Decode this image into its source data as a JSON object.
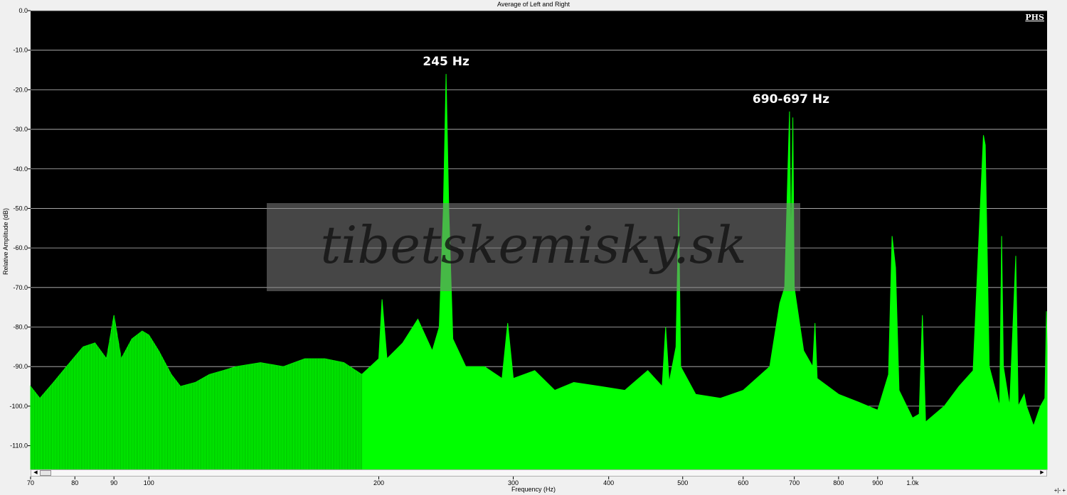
{
  "window": {
    "title": "Average of Left and Right"
  },
  "badge": "PHS",
  "watermark": "tibetskemisky.sk",
  "corner_controls": "+|- +",
  "chart_data": {
    "type": "area",
    "title": "Average of Left and Right",
    "xlabel": "Frequency (Hz)",
    "ylabel": "Relative Amplitude (dB)",
    "xscale": "log",
    "xlim": [
      70,
      1500
    ],
    "ylim": [
      -116,
      0
    ],
    "grid": true,
    "series_color": "#00ff00",
    "background": "#000000",
    "yticks": [
      "0.0",
      "-10.0",
      "-20.0",
      "-30.0",
      "-40.0",
      "-50.0",
      "-60.0",
      "-70.0",
      "-80.0",
      "-90.0",
      "-100.0",
      "-110.0"
    ],
    "ytick_values": [
      0,
      -10,
      -20,
      -30,
      -40,
      -50,
      -60,
      -70,
      -80,
      -90,
      -100,
      -110
    ],
    "xticks": [
      "70",
      "80",
      "90",
      "100",
      "200",
      "300",
      "400",
      "500",
      "600",
      "700",
      "800",
      "900",
      "1.0k"
    ],
    "xtick_values": [
      70,
      80,
      90,
      100,
      200,
      300,
      400,
      500,
      600,
      700,
      800,
      900,
      1000
    ],
    "annotations": [
      {
        "text": "245 Hz",
        "x": 245,
        "y": -16
      },
      {
        "text": "690-697 Hz",
        "x": 693,
        "y": -25.5
      }
    ],
    "points": [
      [
        70,
        -95
      ],
      [
        72,
        -98
      ],
      [
        75,
        -94
      ],
      [
        78,
        -90
      ],
      [
        82,
        -85
      ],
      [
        85,
        -84
      ],
      [
        88,
        -88
      ],
      [
        90,
        -77
      ],
      [
        92,
        -88
      ],
      [
        95,
        -83
      ],
      [
        98,
        -81
      ],
      [
        100,
        -82
      ],
      [
        103,
        -86
      ],
      [
        107,
        -92
      ],
      [
        110,
        -95
      ],
      [
        115,
        -94
      ],
      [
        120,
        -92
      ],
      [
        125,
        -91
      ],
      [
        130,
        -90
      ],
      [
        140,
        -89
      ],
      [
        150,
        -90
      ],
      [
        160,
        -88
      ],
      [
        170,
        -88
      ],
      [
        180,
        -89
      ],
      [
        190,
        -92
      ],
      [
        200,
        -88
      ],
      [
        202,
        -73
      ],
      [
        205,
        -88
      ],
      [
        215,
        -84
      ],
      [
        225,
        -78
      ],
      [
        235,
        -86
      ],
      [
        240,
        -80
      ],
      [
        243,
        -50
      ],
      [
        245,
        -16
      ],
      [
        247,
        -50
      ],
      [
        250,
        -83
      ],
      [
        260,
        -90
      ],
      [
        275,
        -90
      ],
      [
        290,
        -93
      ],
      [
        295,
        -79
      ],
      [
        300,
        -93
      ],
      [
        320,
        -91
      ],
      [
        340,
        -96
      ],
      [
        360,
        -94
      ],
      [
        390,
        -95
      ],
      [
        420,
        -96
      ],
      [
        450,
        -91
      ],
      [
        470,
        -95
      ],
      [
        475,
        -80
      ],
      [
        480,
        -94
      ],
      [
        490,
        -85
      ],
      [
        494,
        -50
      ],
      [
        497,
        -90
      ],
      [
        520,
        -97
      ],
      [
        560,
        -98
      ],
      [
        600,
        -96
      ],
      [
        650,
        -90
      ],
      [
        670,
        -74
      ],
      [
        680,
        -70
      ],
      [
        690,
        -25.5
      ],
      [
        693,
        -60
      ],
      [
        697,
        -27
      ],
      [
        700,
        -70
      ],
      [
        720,
        -86
      ],
      [
        740,
        -90
      ],
      [
        745,
        -79
      ],
      [
        750,
        -93
      ],
      [
        800,
        -97
      ],
      [
        850,
        -99
      ],
      [
        900,
        -101
      ],
      [
        930,
        -92
      ],
      [
        940,
        -57
      ],
      [
        950,
        -65
      ],
      [
        960,
        -96
      ],
      [
        1000,
        -103
      ],
      [
        1020,
        -102
      ],
      [
        1030,
        -77
      ],
      [
        1040,
        -104
      ],
      [
        1100,
        -100
      ],
      [
        1150,
        -95
      ],
      [
        1200,
        -91
      ],
      [
        1238,
        -31.5
      ],
      [
        1245,
        -34
      ],
      [
        1260,
        -90
      ],
      [
        1300,
        -100
      ],
      [
        1308,
        -57
      ],
      [
        1315,
        -90
      ],
      [
        1340,
        -100
      ],
      [
        1365,
        -62
      ],
      [
        1375,
        -100
      ],
      [
        1400,
        -97
      ],
      [
        1410,
        -100
      ],
      [
        1440,
        -105
      ],
      [
        1470,
        -100
      ],
      [
        1490,
        -98
      ],
      [
        1497,
        -76
      ],
      [
        1500,
        -85
      ]
    ]
  }
}
